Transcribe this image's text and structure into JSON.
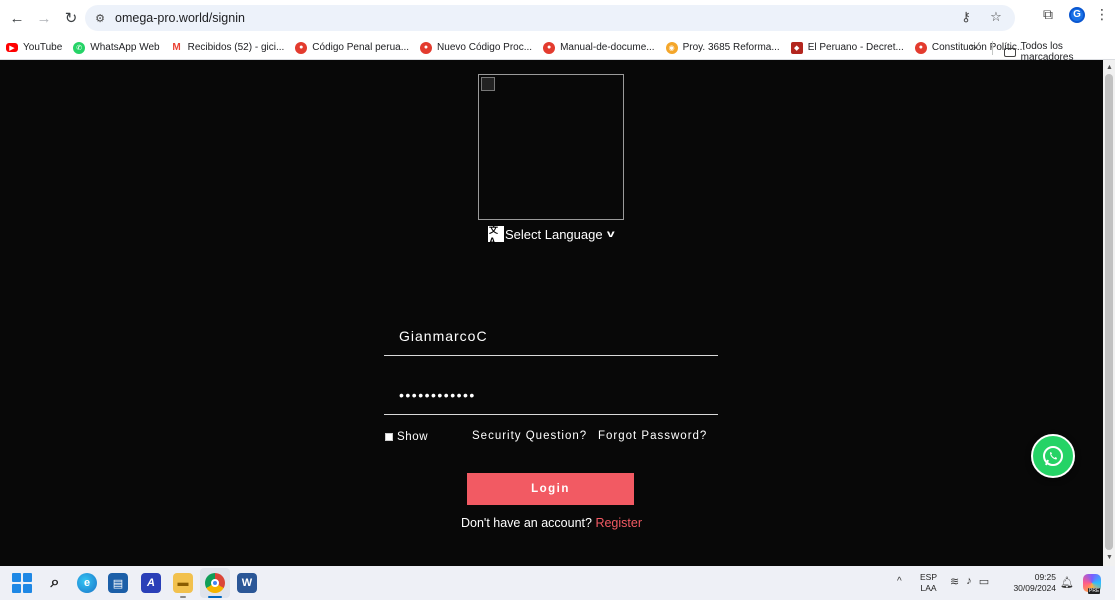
{
  "browser": {
    "url": "omega-pro.world/signin",
    "bookmarks": [
      {
        "label": "YouTube",
        "icon": "youtube-icon"
      },
      {
        "label": "WhatsApp Web",
        "icon": "whatsapp-icon"
      },
      {
        "label": "Recibidos (52) - gici...",
        "icon": "gmail-icon"
      },
      {
        "label": "Código Penal perua...",
        "icon": "pdf-icon"
      },
      {
        "label": "Nuevo Código Proc...",
        "icon": "pdf-icon"
      },
      {
        "label": "Manual-de-docume...",
        "icon": "pdf-icon"
      },
      {
        "label": "Proy. 3685 Reforma...",
        "icon": "congress-icon"
      },
      {
        "label": "El Peruano - Decret...",
        "icon": "shield-icon"
      },
      {
        "label": "Constitución Polític...",
        "icon": "pdf-icon"
      }
    ],
    "more_label": "»",
    "all_bookmarks_label": "Todos los marcadores",
    "profile_initial": "G"
  },
  "signin": {
    "language_label": "Select Language",
    "username_value": "GianmarcoC",
    "password_mask": "••••••••••••",
    "show_label": "Show",
    "security_question": "Security Question?",
    "forgot_password": "Forgot Password?",
    "login_label": "Login",
    "no_account_text": "Don't have an account? ",
    "register_label": "Register",
    "accent_color": "#f25a63",
    "background_color": "#080808"
  },
  "taskbar": {
    "ime_line1": "ESP",
    "ime_line2": "LAA",
    "time": "09:25",
    "date": "30/09/2024",
    "copilot_badge": "PRE"
  }
}
